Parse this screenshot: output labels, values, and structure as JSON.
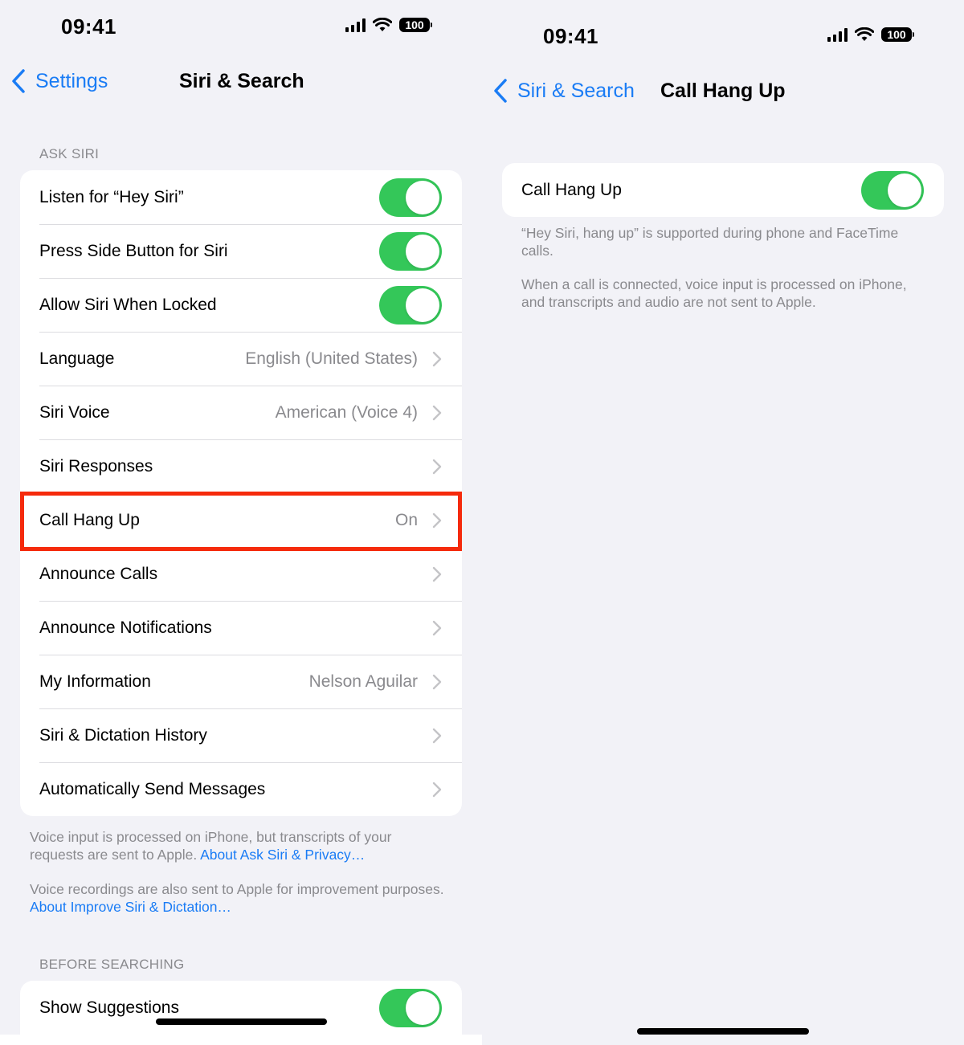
{
  "left": {
    "status": {
      "time": "09:41",
      "battery": "100"
    },
    "nav": {
      "back_label": "Settings",
      "title": "Siri & Search"
    },
    "ask_siri": {
      "header": "ASK SIRI",
      "rows": [
        {
          "label": "Listen for “Hey Siri”",
          "type": "toggle",
          "on": true
        },
        {
          "label": "Press Side Button for Siri",
          "type": "toggle",
          "on": true
        },
        {
          "label": "Allow Siri When Locked",
          "type": "toggle",
          "on": true
        },
        {
          "label": "Language",
          "value": "English (United States)",
          "type": "link"
        },
        {
          "label": "Siri Voice",
          "value": "American (Voice 4)",
          "type": "link"
        },
        {
          "label": "Siri Responses",
          "value": "",
          "type": "link"
        },
        {
          "label": "Call Hang Up",
          "value": "On",
          "type": "link",
          "highlighted": true
        },
        {
          "label": "Announce Calls",
          "value": "",
          "type": "link"
        },
        {
          "label": "Announce Notifications",
          "value": "",
          "type": "link"
        },
        {
          "label": "My Information",
          "value": "Nelson Aguilar",
          "type": "link"
        },
        {
          "label": "Siri & Dictation History",
          "value": "",
          "type": "link"
        },
        {
          "label": "Automatically Send Messages",
          "value": "",
          "type": "link"
        }
      ],
      "footer1_text": "Voice input is processed on iPhone, but transcripts of your requests are sent to Apple. ",
      "footer1_link": "About Ask Siri & Privacy…",
      "footer2_text": "Voice recordings are also sent to Apple for improvement purposes. ",
      "footer2_link": "About Improve Siri & Dictation…"
    },
    "before_searching": {
      "header": "BEFORE SEARCHING",
      "rows": [
        {
          "label": "Show Suggestions",
          "type": "toggle",
          "on": true
        }
      ]
    }
  },
  "right": {
    "status": {
      "time": "09:41",
      "battery": "100"
    },
    "nav": {
      "back_label": "Siri & Search",
      "title": "Call Hang Up"
    },
    "row": {
      "label": "Call Hang Up",
      "on": true
    },
    "footer1": "“Hey Siri, hang up” is supported during phone and FaceTime calls.",
    "footer2": "When a call is connected, voice input is processed on iPhone, and transcripts and audio are not sent to Apple."
  },
  "colors": {
    "accent": "#1a7cf5",
    "toggle_on": "#34c759",
    "highlight": "#f52a0c",
    "background": "#f2f2f7",
    "secondary_text": "#8a8a8e"
  }
}
